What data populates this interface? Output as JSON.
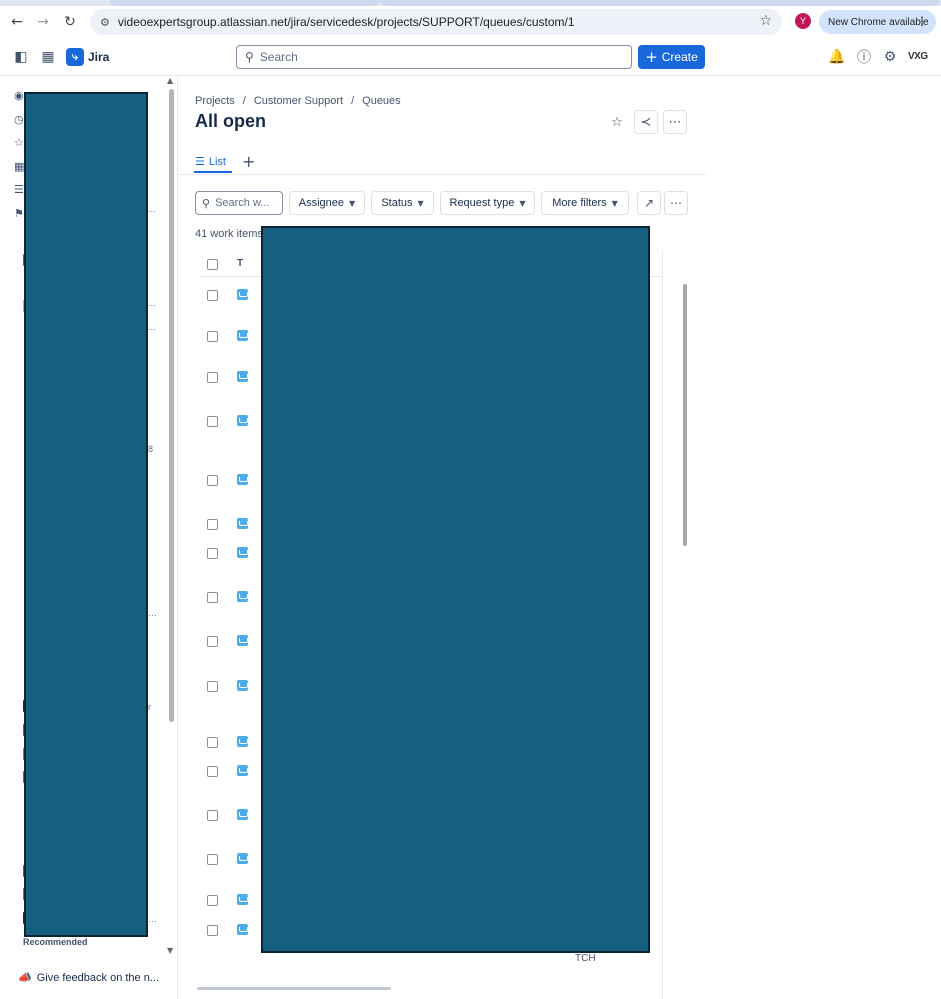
{
  "browser": {
    "url": "videoexpertsgroup.atlassian.net/jira/servicedesk/projects/SUPPORT/queues/custom/1",
    "profile_initial": "Y",
    "update_label": "New Chrome available"
  },
  "topnav": {
    "app_name": "Jira",
    "search_placeholder": "Search",
    "create_label": "Create",
    "org_label": "VXG"
  },
  "sidebar": {
    "recommended_label": "Recommended",
    "feedback_label": "Give feedback on the n...",
    "fragments": [
      "...",
      "...",
      "...",
      "…",
      "r",
      "…",
      "8"
    ]
  },
  "main": {
    "breadcrumb": [
      "Projects",
      "/",
      "Customer Support",
      "/",
      "Queues"
    ],
    "title": "All open",
    "tab_list_label": "List",
    "search_placeholder": "Search w...",
    "filters": [
      "Assignee",
      "Status",
      "Request type",
      "More filters"
    ],
    "count_label": "41 work items",
    "column_t": "T",
    "footer_fragment": "TCH"
  },
  "colors": {
    "brand": "#1868db",
    "redaction": "#175f80",
    "issue_type": "#4bade8"
  }
}
